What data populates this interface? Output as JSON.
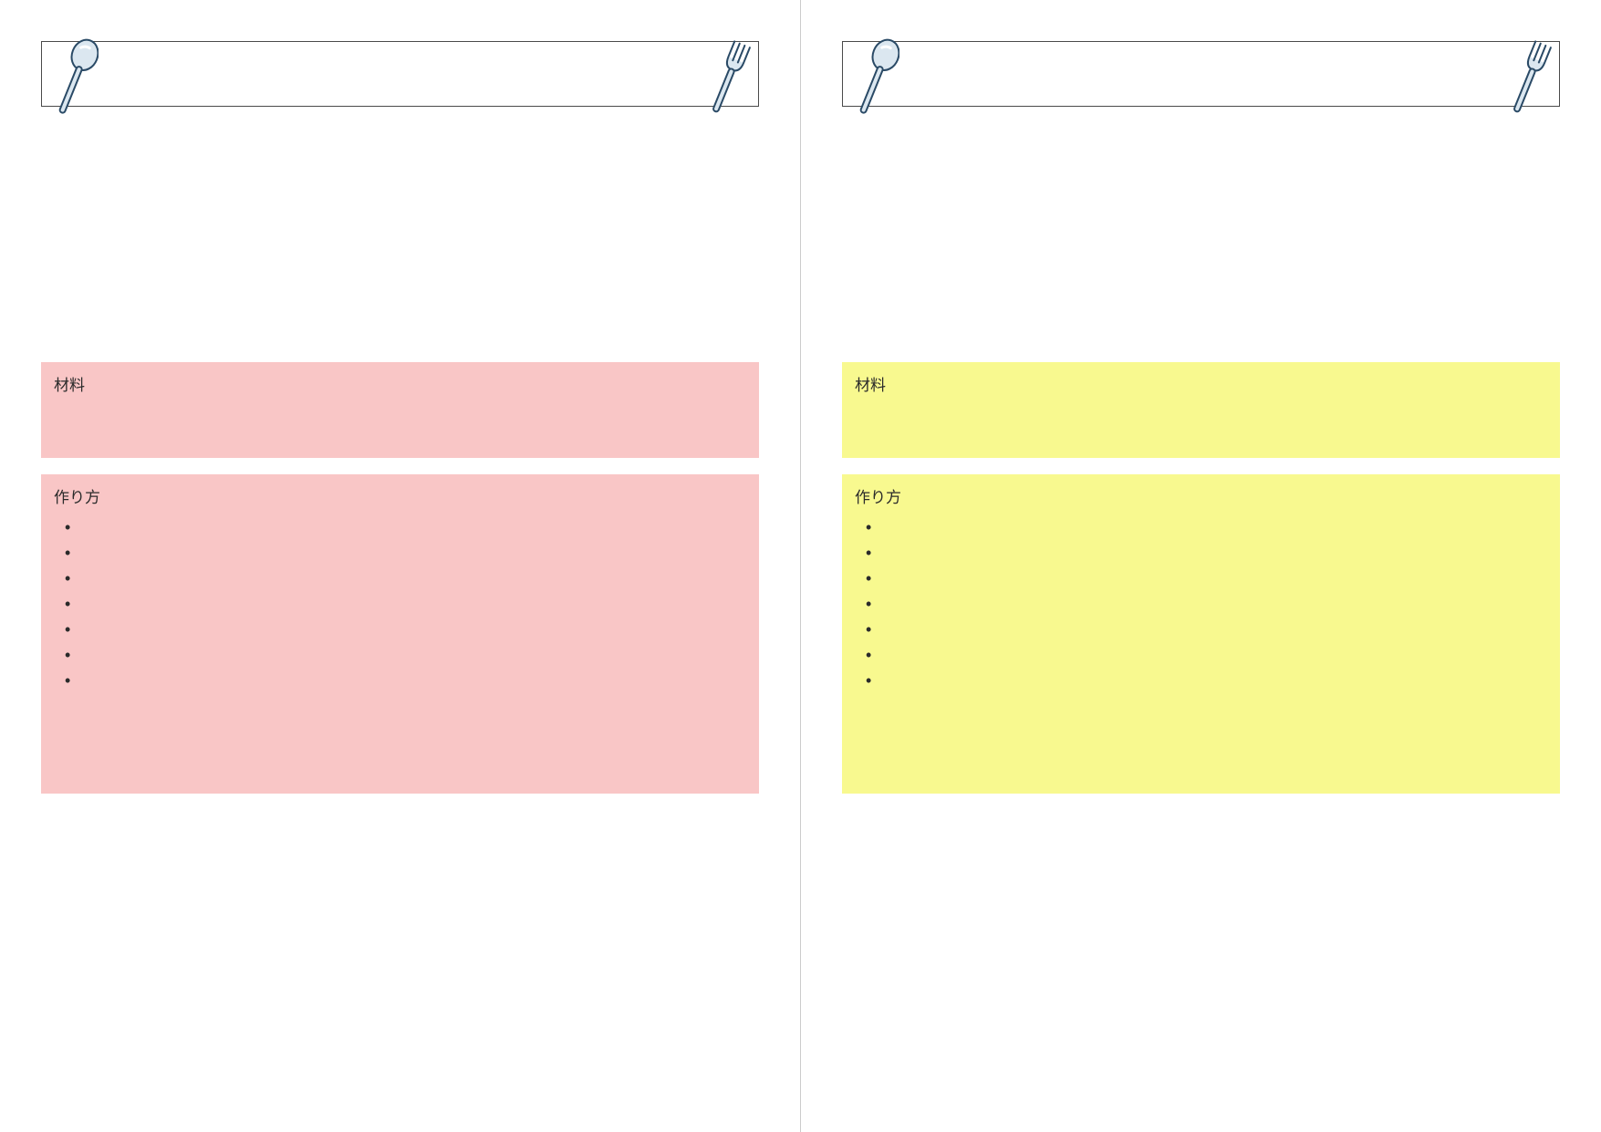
{
  "pages": [
    {
      "accent": "pink",
      "ingredients_label": "材料",
      "instructions_label": "作り方",
      "bullets": [
        "",
        "",
        "",
        "",
        "",
        "",
        ""
      ]
    },
    {
      "accent": "yellow",
      "ingredients_label": "材料",
      "instructions_label": "作り方",
      "bullets": [
        "",
        "",
        "",
        "",
        "",
        "",
        ""
      ]
    }
  ],
  "icons": {
    "spoon": "spoon-icon",
    "fork": "fork-icon"
  }
}
